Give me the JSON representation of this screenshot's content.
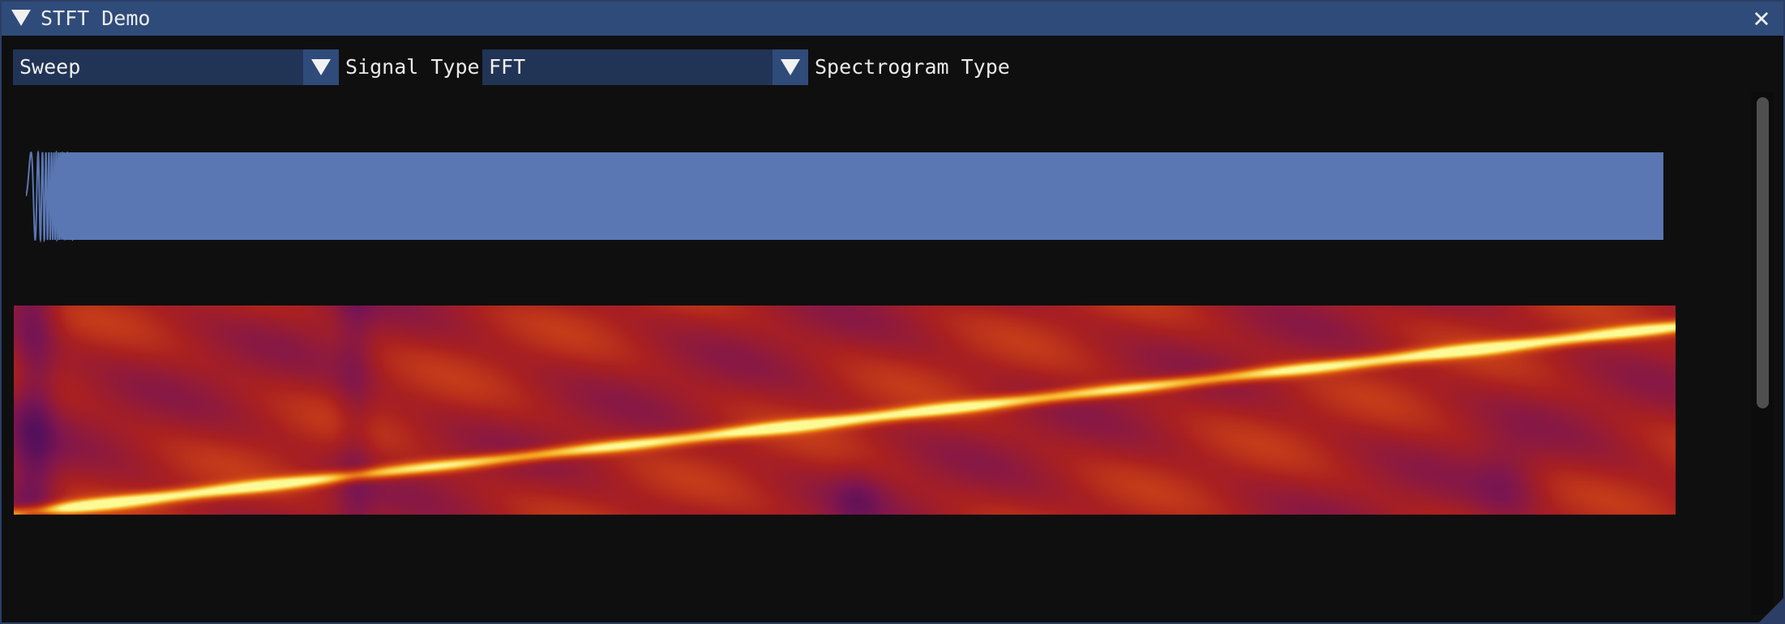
{
  "window": {
    "title": "STFT Demo",
    "colors": {
      "titlebar": "#2f4b7a",
      "background": "#0f0f0f",
      "combo": "#213455",
      "accent": "#2f4b7a"
    }
  },
  "controls": {
    "signal_type": {
      "value": "Sweep",
      "label": "Signal Type"
    },
    "spectrogram_type": {
      "value": "FFT",
      "label": "Spectrogram Type"
    }
  },
  "icons": {
    "collapse": "triangle-down-icon",
    "close": "close-icon",
    "dropdown": "chevron-down-icon",
    "resize": "resize-grip-icon"
  },
  "chart_data": [
    {
      "type": "area",
      "signal": "sweep",
      "color": "#5a77b3",
      "amplitude_range": [
        -1,
        1
      ],
      "grid": false
    },
    {
      "type": "heatmap",
      "colormap": "inferno",
      "ridge": {
        "start": 0.0,
        "end": 0.9
      },
      "grid": false
    }
  ]
}
